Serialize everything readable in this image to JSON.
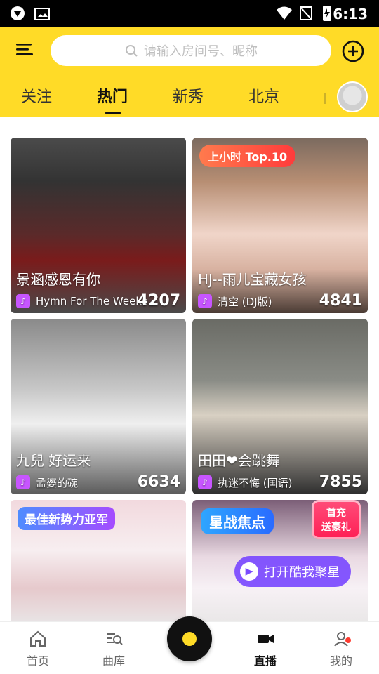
{
  "status_bar": {
    "time": "6:13"
  },
  "header": {
    "search": {
      "placeholder": "请输入房间号、昵称"
    },
    "tabs": [
      {
        "label": "关注"
      },
      {
        "label": "热门"
      },
      {
        "label": "新秀"
      },
      {
        "label": "北京"
      }
    ]
  },
  "feed": {
    "cards": [
      {
        "title": "景涵感恩有你",
        "song": "Hymn For The Weeke...",
        "count": "4207"
      },
      {
        "badge": "上小时 Top.10",
        "title": "HJ--雨儿宝藏女孩",
        "song": "清空 (DJ版)",
        "count": "4841"
      },
      {
        "title": "九兒 好运来",
        "song": "孟婆的碗",
        "count": "6634"
      },
      {
        "title": "田田❤会跳舞",
        "song": "执迷不悔 (国语)",
        "count": "7855"
      },
      {
        "banner": "最佳新势力亚军"
      },
      {
        "banner": "星战焦点",
        "promo": "首充\n送豪礼",
        "cta": "打开酷我聚星"
      }
    ]
  },
  "bottom_nav": {
    "items": [
      {
        "label": "首页"
      },
      {
        "label": "曲库"
      },
      {
        "label": "直播"
      },
      {
        "label": "我的"
      }
    ]
  },
  "colors": {
    "brand_yellow": "#FFDB27",
    "accent_purple": "#7A4BFF",
    "top_badge_red": "#FF3B3B",
    "notification_red": "#FF3B30"
  },
  "icons": {
    "menu": "menu-icon",
    "add": "add-circle-icon",
    "search": "search-icon",
    "home": "home-icon",
    "library": "library-search-icon",
    "live": "camera-icon",
    "me": "user-icon",
    "music": "music-note-icon",
    "play": "play-icon"
  }
}
